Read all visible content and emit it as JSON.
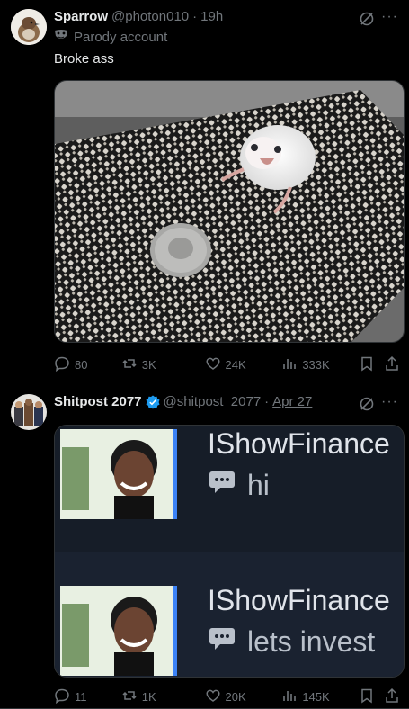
{
  "tweets": [
    {
      "name": "Sparrow",
      "handle": "@photon010",
      "sep": "·",
      "time": "19h",
      "badge": "Parody account",
      "text": "Broke ass",
      "actions": {
        "replies": "80",
        "reposts": "3K",
        "likes": "24K",
        "views": "333K"
      }
    },
    {
      "name": "Shitpost 2077",
      "handle": "@shitpost_2077",
      "sep": "·",
      "time": "Apr 27",
      "media": {
        "row1_name": "IShowFinance",
        "row1_msg": "hi",
        "row2_name": "IShowFinance",
        "row2_msg": "lets invest"
      },
      "actions": {
        "replies": "11",
        "reposts": "1K",
        "likes": "20K",
        "views": "145K"
      }
    }
  ],
  "colors": {
    "background": "#000000",
    "text": "#e7e9ea",
    "muted": "#71767b",
    "verified": "#1d9bf0",
    "divider": "#2f3336"
  },
  "more_label": "···"
}
